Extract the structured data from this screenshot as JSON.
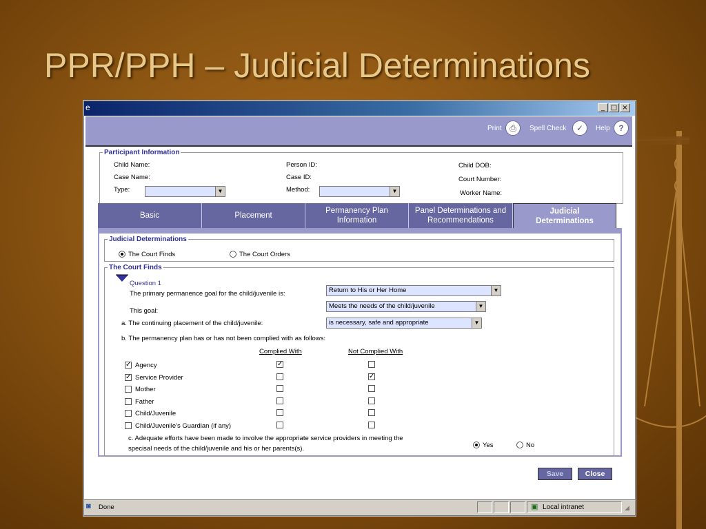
{
  "slide": {
    "title": "PPR/PPH – Judicial Determinations"
  },
  "window": {
    "controls": {
      "minimize": "_",
      "maximize": "□",
      "close": "×"
    }
  },
  "toolbar": {
    "print": "Print",
    "spell_check": "Spell Check",
    "help": "Help"
  },
  "participant": {
    "legend": "Participant Information",
    "child_name": "Child Name:",
    "person_id": "Person ID:",
    "child_dob": "Child DOB:",
    "case_name": "Case Name:",
    "case_id": "Case ID:",
    "court_number": "Court Number:",
    "type": "Type:",
    "method": "Method:",
    "worker_name": "Worker Name:"
  },
  "tabs": [
    {
      "label": "Basic"
    },
    {
      "label": "Placement"
    },
    {
      "label": "Permanency Plan Information"
    },
    {
      "label": "Panel Determinations and Recommendations"
    },
    {
      "label": "Judicial Determinations"
    }
  ],
  "judicial": {
    "legend": "Judicial Determinations",
    "court_finds": "The Court Finds",
    "court_orders": "The Court Orders",
    "selected": "The Court Finds"
  },
  "court_finds": {
    "legend": "The Court Finds",
    "question_label": "Question 1",
    "q_goal": "The primary permanence goal for the child/juvenile is:",
    "goal_value": "Return to His or Her Home",
    "this_goal": "This goal:",
    "this_goal_value": "Meets the needs of the child/juvenile",
    "q_a": "a. The continuing placement of the child/juvenile:",
    "a_value": "is necessary, safe and appropriate",
    "q_b": "b. The permanency plan has or has not been complied with as follows:",
    "col_complied": "Complied With",
    "col_not_complied": "Not Complied With",
    "rows": [
      {
        "label": "Agency",
        "checked": true,
        "complied": true,
        "not_complied": false
      },
      {
        "label": "Service Provider",
        "checked": true,
        "complied": false,
        "not_complied": true
      },
      {
        "label": "Mother",
        "checked": false,
        "complied": false,
        "not_complied": false
      },
      {
        "label": "Father",
        "checked": false,
        "complied": false,
        "not_complied": false
      },
      {
        "label": "Child/Juvenile",
        "checked": false,
        "complied": false,
        "not_complied": false
      },
      {
        "label": "Child/Juvenile's Guardian (if any)",
        "checked": false,
        "complied": false,
        "not_complied": false
      }
    ],
    "q_c_line1": "c. Adequate efforts have been made to involve the appropriate service providers in meeting the",
    "q_c_line2": "specisal needs of the child/juvenile and his or her parents(s).",
    "yes": "Yes",
    "no": "No",
    "c_selected": "Yes"
  },
  "actions": {
    "save": "Save",
    "close": "Close"
  },
  "statusbar": {
    "status": "Done",
    "zone": "Local intranet"
  }
}
